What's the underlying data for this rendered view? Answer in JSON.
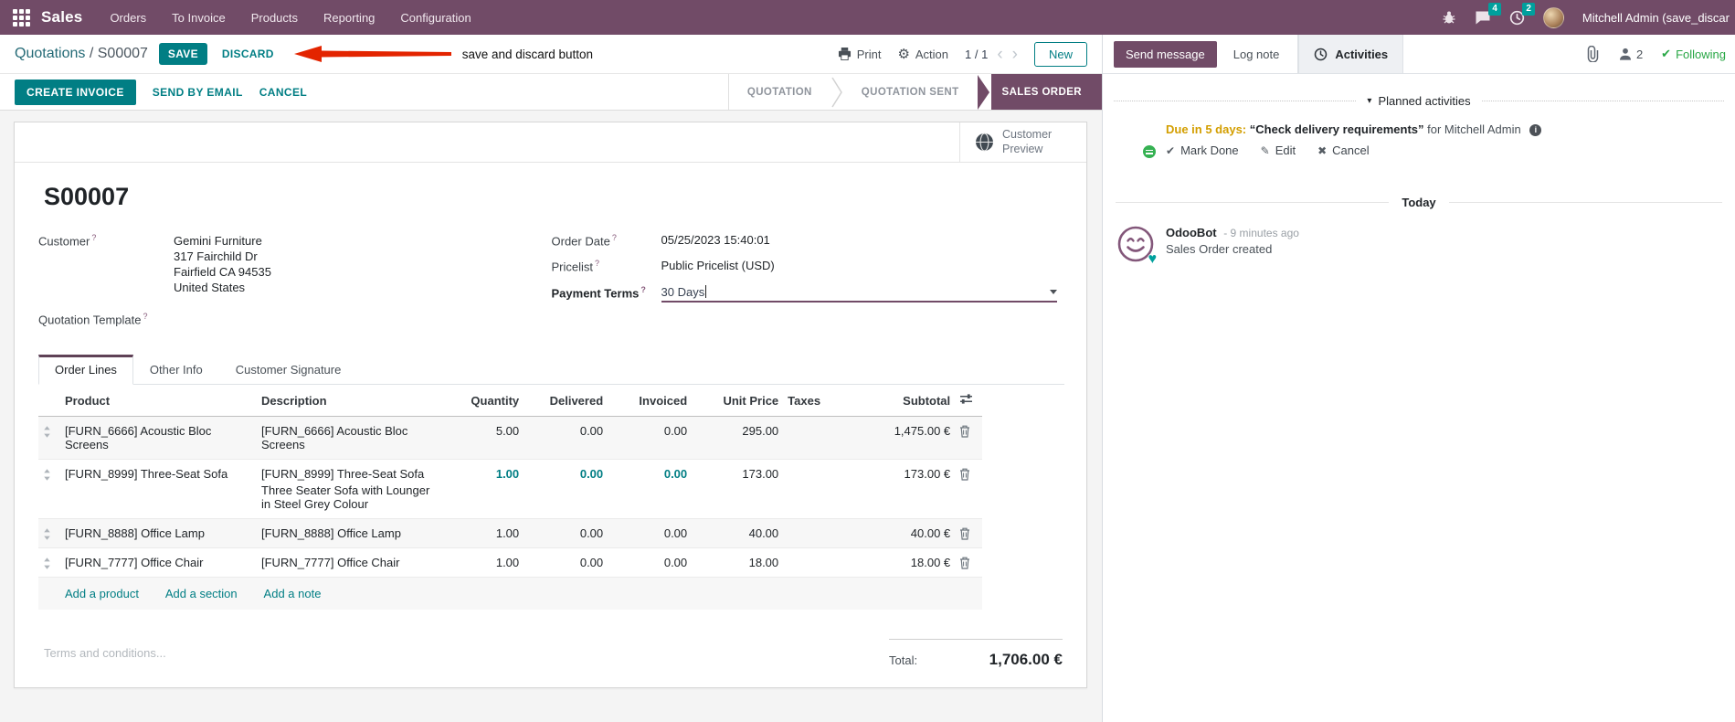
{
  "navbar": {
    "app_name": "Sales",
    "menus": [
      "Orders",
      "To Invoice",
      "Products",
      "Reporting",
      "Configuration"
    ],
    "messages_badge": "4",
    "activities_badge": "2",
    "user_name": "Mitchell Admin (save_discar"
  },
  "control_panel": {
    "breadcrumb_parent": "Quotations",
    "breadcrumb_sep": "/",
    "breadcrumb_current": "S00007",
    "save_label": "SAVE",
    "discard_label": "DISCARD",
    "annotation_text": "save and discard button",
    "print_label": "Print",
    "action_label": "Action",
    "pager_value": "1 / 1",
    "new_label": "New"
  },
  "statusbar": {
    "create_invoice": "CREATE INVOICE",
    "send_by_email": "SEND BY EMAIL",
    "cancel": "CANCEL",
    "stages": [
      "QUOTATION",
      "QUOTATION SENT",
      "SALES ORDER"
    ],
    "active_stage": "SALES ORDER"
  },
  "sheet": {
    "customer_preview_label": "Customer Preview",
    "title": "S00007",
    "help_marker": "?",
    "customer": {
      "label": "Customer",
      "name": "Gemini Furniture",
      "address_line1": "317 Fairchild Dr",
      "address_line2": "Fairfield CA 94535",
      "address_line3": "United States"
    },
    "quotation_template_label": "Quotation Template",
    "order_date": {
      "label": "Order Date",
      "value": "05/25/2023 15:40:01"
    },
    "pricelist": {
      "label": "Pricelist",
      "value": "Public Pricelist (USD)"
    },
    "payment_terms": {
      "label": "Payment Terms",
      "value": "30 Days"
    },
    "tabs": [
      "Order Lines",
      "Other Info",
      "Customer Signature"
    ],
    "order_lines": {
      "columns": [
        "Product",
        "Description",
        "Quantity",
        "Delivered",
        "Invoiced",
        "Unit Price",
        "Taxes",
        "Subtotal"
      ],
      "rows": [
        {
          "product": "[FURN_6666] Acoustic Bloc Screens",
          "description": "[FURN_6666] Acoustic Bloc Screens",
          "quantity": "5.00",
          "delivered": "0.00",
          "invoiced": "0.00",
          "unit_price": "295.00",
          "taxes": "",
          "subtotal": "1,475.00 €"
        },
        {
          "product": "[FURN_8999] Three-Seat Sofa",
          "description": "[FURN_8999] Three-Seat Sofa",
          "description2": "Three Seater Sofa with Lounger in Steel Grey Colour",
          "quantity": "1.00",
          "delivered": "0.00",
          "invoiced": "0.00",
          "unit_price": "173.00",
          "taxes": "",
          "subtotal": "173.00 €"
        },
        {
          "product": "[FURN_8888] Office Lamp",
          "description": "[FURN_8888] Office Lamp",
          "quantity": "1.00",
          "delivered": "0.00",
          "invoiced": "0.00",
          "unit_price": "40.00",
          "taxes": "",
          "subtotal": "40.00 €"
        },
        {
          "product": "[FURN_7777] Office Chair",
          "description": "[FURN_7777] Office Chair",
          "quantity": "1.00",
          "delivered": "0.00",
          "invoiced": "0.00",
          "unit_price": "18.00",
          "taxes": "",
          "subtotal": "18.00 €"
        }
      ],
      "add_product": "Add a product",
      "add_section": "Add a section",
      "add_note": "Add a note"
    },
    "terms_placeholder": "Terms and conditions...",
    "total_label": "Total:",
    "total_value": "1,706.00 €"
  },
  "chatter": {
    "send_message": "Send message",
    "log_note": "Log note",
    "activities": "Activities",
    "followers_count": "2",
    "following": "Following",
    "planned_header": "Planned activities",
    "activity": {
      "due": "Due in 5 days:",
      "summary": "“Check delivery requirements”",
      "assignee": "for Mitchell Admin",
      "mark_done": "Mark Done",
      "edit": "Edit",
      "cancel": "Cancel"
    },
    "today": "Today",
    "message": {
      "author": "OdooBot",
      "time": "- 9 minutes ago",
      "body": "Sales Order created"
    }
  },
  "icons": {
    "gear": "⚙",
    "check": "✔",
    "pencil": "✎",
    "close": "✖",
    "caret_down": "▾",
    "info": "i",
    "prev": "‹",
    "next": "›"
  },
  "colors": {
    "navbar_bg": "#714B67",
    "primary_teal": "#017E84",
    "badge_teal": "#00A09D",
    "stage_active_bg": "#714B67",
    "annotation_red": "#E32400",
    "due_warning": "#D39E00",
    "following_green": "#28A745"
  }
}
